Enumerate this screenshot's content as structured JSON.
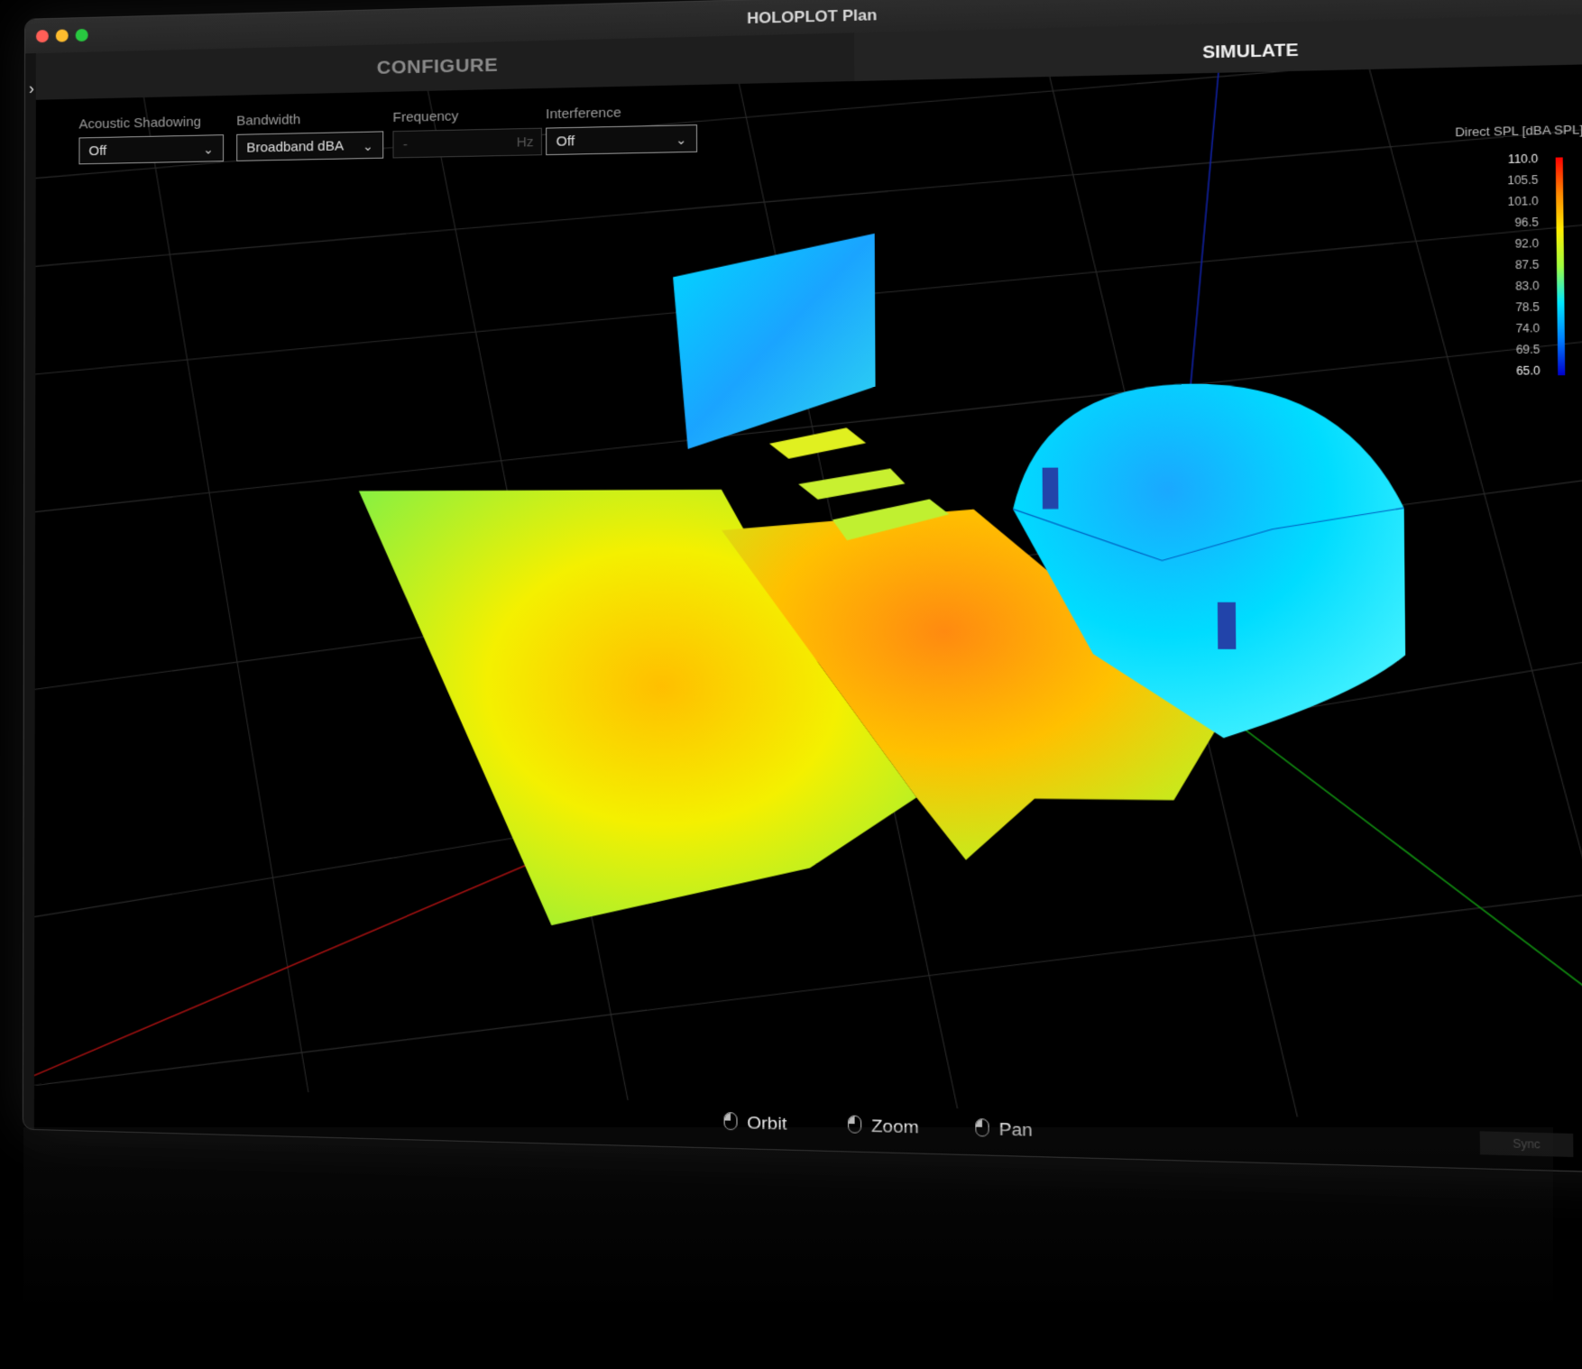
{
  "app": {
    "title": "HOLOPLOT Plan"
  },
  "tabs": {
    "configure": "CONFIGURE",
    "simulate": "SIMULATE"
  },
  "sidebar": {
    "toggle_icon": "chevron-right-icon"
  },
  "controls": {
    "acoustic_shadowing": {
      "label": "Acoustic Shadowing",
      "value": "Off"
    },
    "bandwidth": {
      "label": "Bandwidth",
      "value": "Broadband dBA"
    },
    "frequency": {
      "label": "Frequency",
      "value": "-",
      "unit": "Hz"
    },
    "interference": {
      "label": "Interference",
      "value": "Off"
    }
  },
  "legend": {
    "title": "Direct SPL [dBA SPL]",
    "ticks": [
      "110.0",
      "105.5",
      "101.0",
      "96.5",
      "92.0",
      "87.5",
      "83.0",
      "78.5",
      "74.0",
      "69.5",
      "65.0"
    ],
    "gradient_colors": [
      "#ff0000",
      "#ff8800",
      "#ffee00",
      "#a0ff40",
      "#00e8ff",
      "#0080ff",
      "#0000cc"
    ]
  },
  "toolbar": {
    "pointer_icon": "pointer-icon",
    "columns_icon": "columns-icon",
    "layout_icon": "layout-icon",
    "help_icon": "help-icon"
  },
  "bottom": {
    "orbit": "Orbit",
    "zoom": "Zoom",
    "pan": "Pan",
    "sync": "Sync"
  }
}
